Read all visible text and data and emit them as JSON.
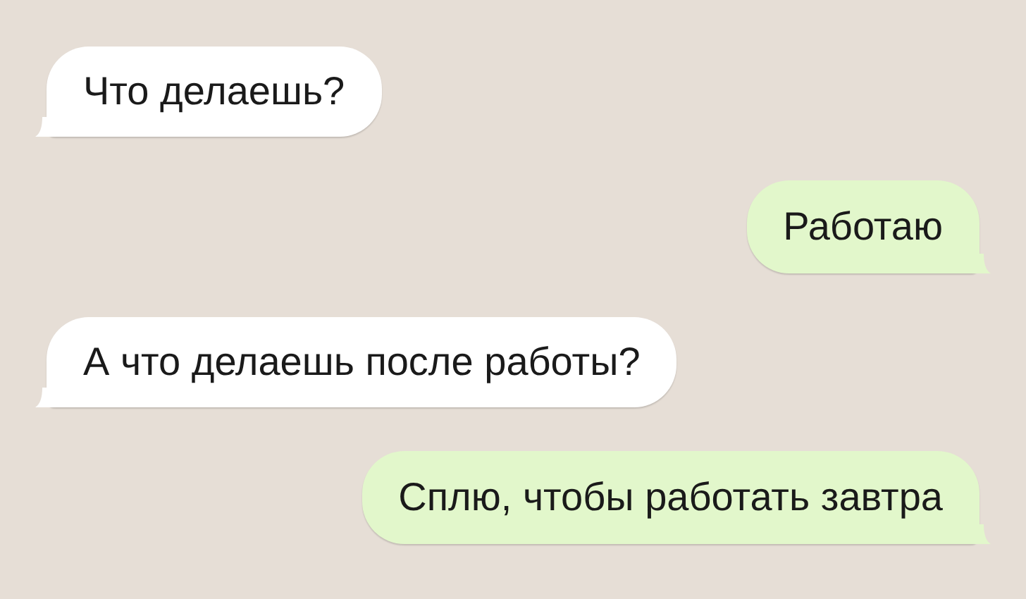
{
  "messages": [
    {
      "kind": "incoming",
      "text": "Что делаешь?"
    },
    {
      "kind": "outgoing",
      "text": "Работаю"
    },
    {
      "kind": "incoming",
      "text": "А что делаешь после работы?"
    },
    {
      "kind": "outgoing",
      "text": "Сплю, чтобы работать завтра"
    }
  ]
}
